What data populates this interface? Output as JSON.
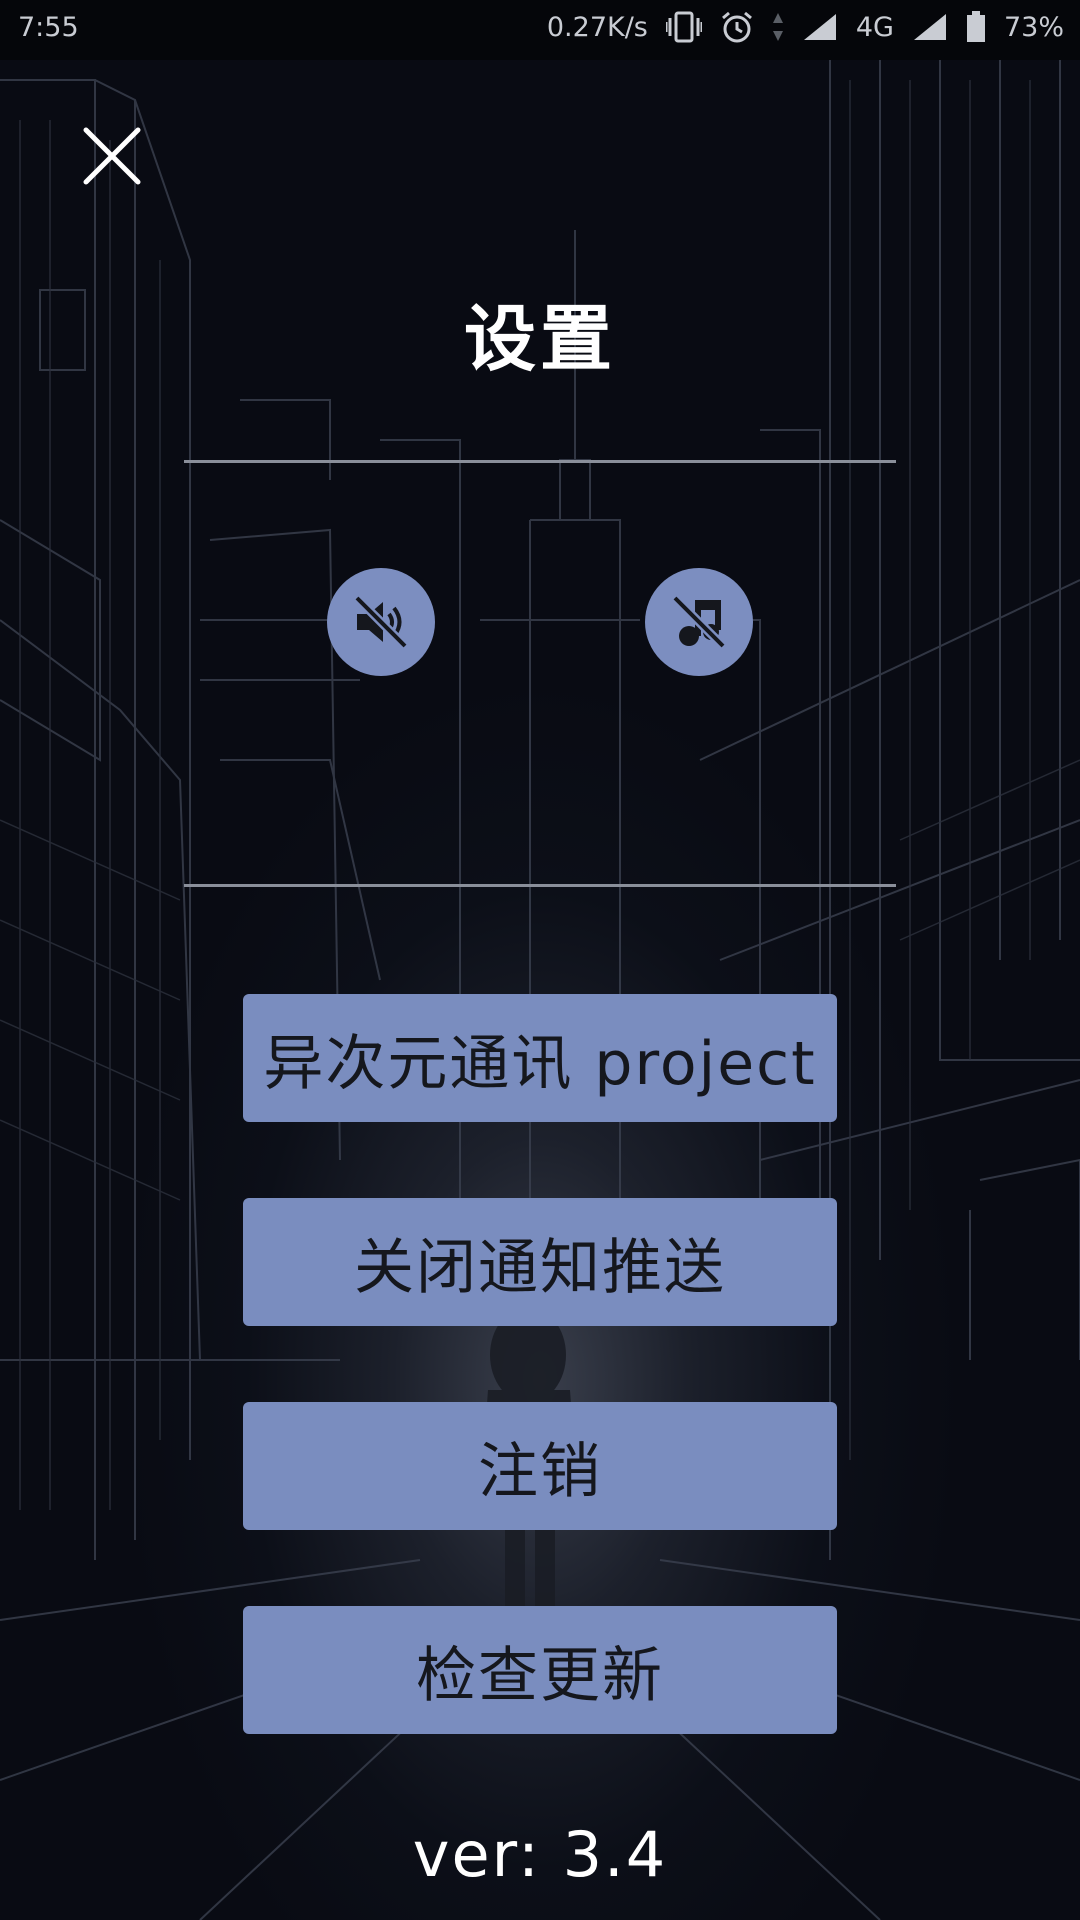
{
  "status_bar": {
    "time": "7:55",
    "net_speed": "0.27K/s",
    "network": "4G",
    "battery": "73%",
    "icons": [
      "vibrate-icon",
      "alarm-icon",
      "data-arrows-icon",
      "signal-icon",
      "signal-icon",
      "battery-icon"
    ]
  },
  "header": {
    "close_icon": "close-icon",
    "title": "设置"
  },
  "toggles": [
    {
      "icon": "sound-off-icon"
    },
    {
      "icon": "music-off-icon"
    }
  ],
  "menu": {
    "items": [
      {
        "label": "异次元通讯 project"
      },
      {
        "label": "关闭通知推送"
      },
      {
        "label": "注销"
      },
      {
        "label": "检查更新"
      }
    ]
  },
  "footer": {
    "version": "ver: 3.4"
  },
  "colors": {
    "button": "#7a8dbf",
    "text_dark": "#15171d",
    "background": "#0a0d16"
  }
}
